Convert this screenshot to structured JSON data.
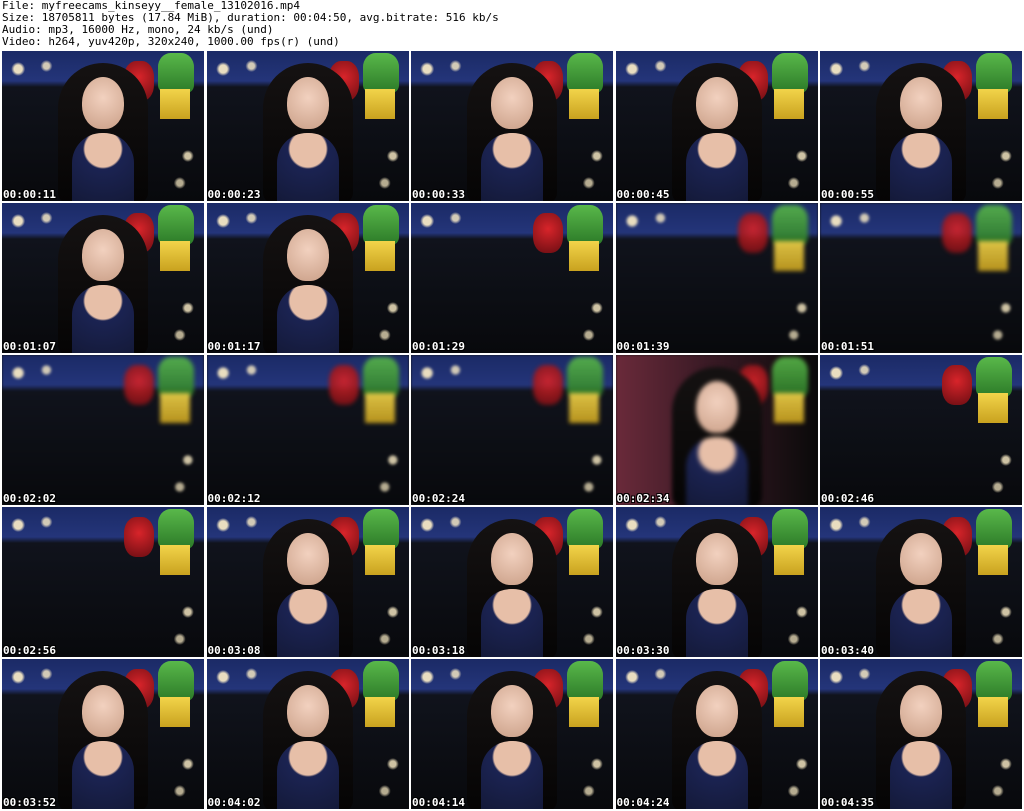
{
  "header": {
    "file_line": "File: myfreecams_kinseyy__female_13102016.mp4",
    "size_line": "Size: 18705811 bytes (17.84 MiB), duration: 00:04:50, avg.bitrate: 516 kb/s",
    "audio_line": "Audio: mp3, 16000 Hz, mono, 24 kb/s (und)",
    "video_line": "Video: h264, yuv420p, 320x240, 1000.00 fps(r) (und)"
  },
  "thumbnails": [
    {
      "timestamp": "00:00:11",
      "scene": "person"
    },
    {
      "timestamp": "00:00:23",
      "scene": "person"
    },
    {
      "timestamp": "00:00:33",
      "scene": "person"
    },
    {
      "timestamp": "00:00:45",
      "scene": "person"
    },
    {
      "timestamp": "00:00:55",
      "scene": "person"
    },
    {
      "timestamp": "00:01:07",
      "scene": "person"
    },
    {
      "timestamp": "00:01:17",
      "scene": "person"
    },
    {
      "timestamp": "00:01:29",
      "scene": "empty"
    },
    {
      "timestamp": "00:01:39",
      "scene": "empty-blurred"
    },
    {
      "timestamp": "00:01:51",
      "scene": "empty-blurred"
    },
    {
      "timestamp": "00:02:02",
      "scene": "empty-blurred"
    },
    {
      "timestamp": "00:02:12",
      "scene": "empty-blurred"
    },
    {
      "timestamp": "00:02:24",
      "scene": "empty-blurred"
    },
    {
      "timestamp": "00:02:34",
      "scene": "person-blurred"
    },
    {
      "timestamp": "00:02:46",
      "scene": "empty"
    },
    {
      "timestamp": "00:02:56",
      "scene": "empty"
    },
    {
      "timestamp": "00:03:08",
      "scene": "person"
    },
    {
      "timestamp": "00:03:18",
      "scene": "person"
    },
    {
      "timestamp": "00:03:30",
      "scene": "person"
    },
    {
      "timestamp": "00:03:40",
      "scene": "person"
    },
    {
      "timestamp": "00:03:52",
      "scene": "person"
    },
    {
      "timestamp": "00:04:02",
      "scene": "person"
    },
    {
      "timestamp": "00:04:14",
      "scene": "person"
    },
    {
      "timestamp": "00:04:24",
      "scene": "person"
    },
    {
      "timestamp": "00:04:35",
      "scene": "person"
    }
  ]
}
